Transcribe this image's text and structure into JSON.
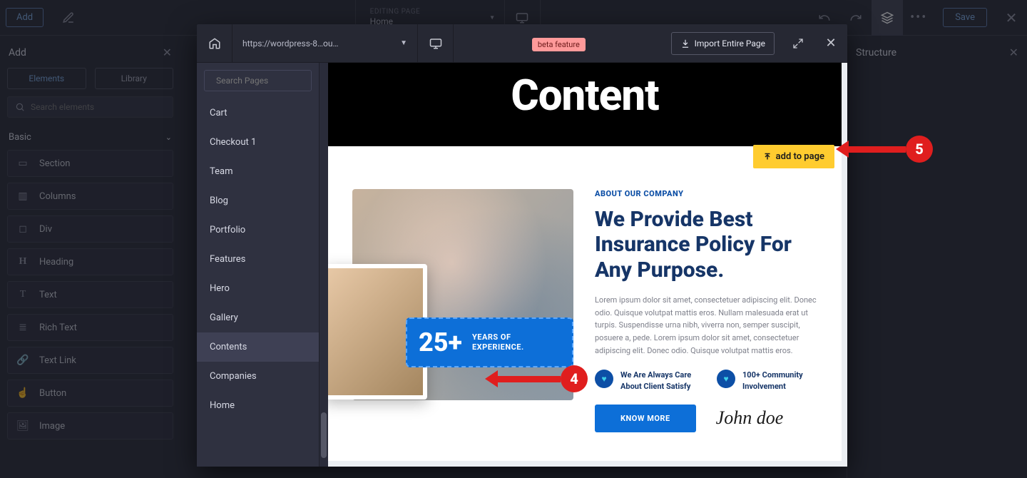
{
  "topbar": {
    "add_label": "Add",
    "editing_label": "EDITING PAGE",
    "editing_page": "Home",
    "save_label": "Save"
  },
  "left_panel": {
    "title": "Add",
    "tab_elements": "Elements",
    "tab_library": "Library",
    "search_placeholder": "Search elements",
    "category": "Basic",
    "elements": {
      "section": "Section",
      "columns": "Columns",
      "div": "Div",
      "heading": "Heading",
      "text": "Text",
      "rich_text": "Rich Text",
      "text_link": "Text Link",
      "button": "Button",
      "image": "Image"
    }
  },
  "right_panel": {
    "title": "Structure"
  },
  "modal": {
    "url": "https://wordpress-8…ou…",
    "beta_label": "beta feature",
    "import_label": "Import Entire Page",
    "search_pages_placeholder": "Search Pages",
    "pages": {
      "cart": "Cart",
      "checkout": "Checkout 1",
      "team": "Team",
      "blog": "Blog",
      "portfolio": "Portfolio",
      "features": "Features",
      "hero": "Hero",
      "gallery": "Gallery",
      "contents": "Contents",
      "companies": "Companies",
      "home": "Home"
    },
    "add_to_page": "add to page"
  },
  "preview": {
    "hero_title": "Content",
    "eyebrow": "ABOUT OUR COMPANY",
    "headline": "We Provide Best Insurance Policy For Any Purpose.",
    "paragraph": "Lorem ipsum dolor sit amet, consectetuer adipiscing elit. Donec odio. Quisque volutpat mattis eros. Nullam malesuada erat ut turpis. Suspendisse urna nibh, viverra non, semper suscipit, posuere a, pede. Lorem ipsum dolor sit amet, consectetuer adipiscing elit. Donec odio. Quisque volutpat mattis eros.",
    "stat_value": "25+",
    "stat_label": "YEARS OF EXPERIENCE.",
    "feature1": "We Are Always Care About Client Satisfy",
    "feature2": "100+ Community Involvement",
    "cta": "KNOW MORE",
    "signature": "John doe"
  },
  "callouts": {
    "n4": "4",
    "n5": "5"
  }
}
